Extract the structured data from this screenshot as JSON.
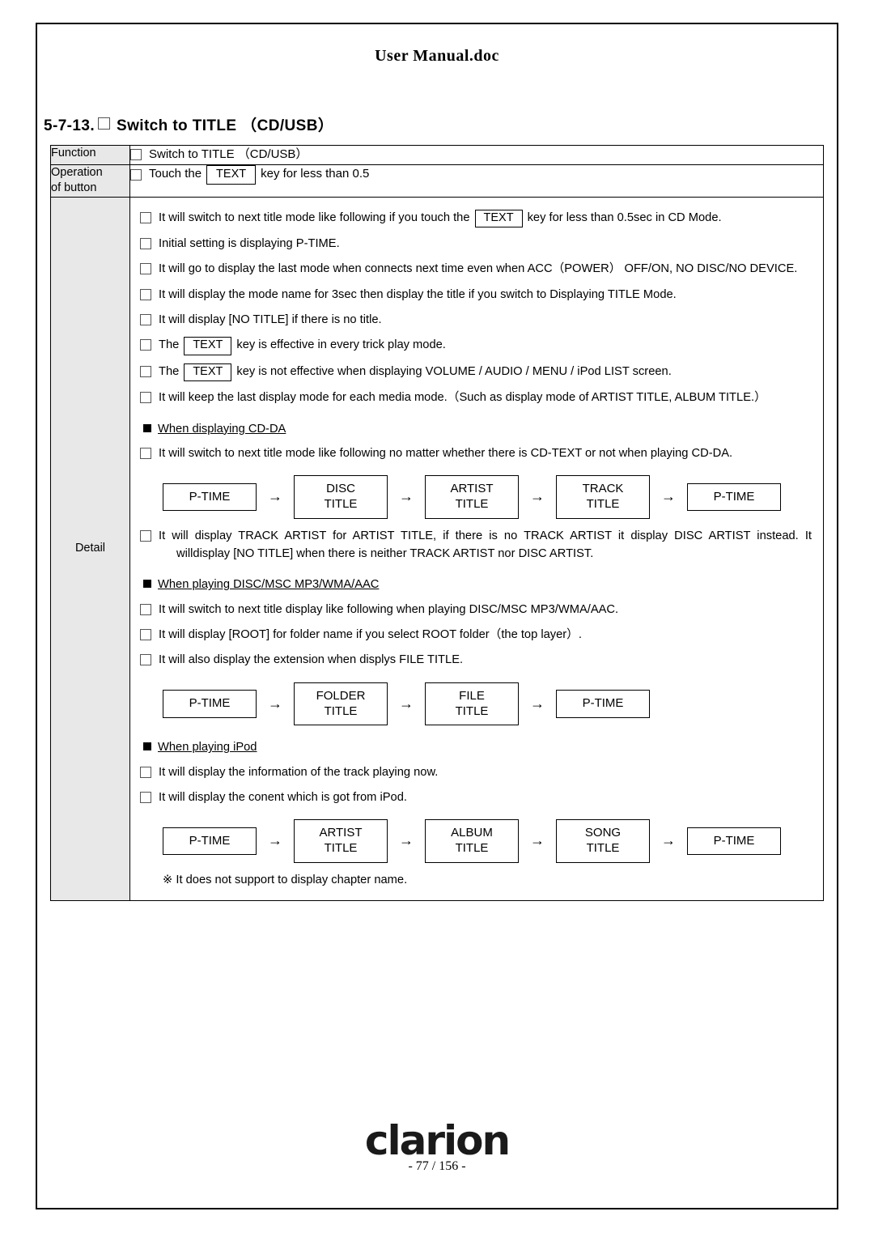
{
  "document": {
    "title": "User Manual.doc",
    "section_number": "5-7-13.",
    "section_title": "Switch to TITLE （CD/USB）",
    "brand": "clarion",
    "page_number": "- 77 / 156 -"
  },
  "table": {
    "labels": {
      "function": "Function",
      "operation_line1": "Operation",
      "operation_line2": "of button",
      "detail": "Detail"
    },
    "function_value": "Switch to TITLE （CD/USB）",
    "operation": {
      "pre": "Touch the",
      "key": "TEXT",
      "post": "key for less than 0.5"
    }
  },
  "detail": {
    "items": [
      {
        "pre": "It will switch to next title mode like following if you touch the",
        "key": "TEXT",
        "post": "key for less than 0.5sec in CD Mode."
      },
      {
        "text": "Initial setting is displaying P-TIME."
      },
      {
        "text": "It will go to display the last mode when connects next time even when ACC（POWER） OFF/ON, NO DISC/NO DEVICE."
      },
      {
        "text": "It will display the mode name for 3sec then display the title if you switch to Displaying TITLE Mode."
      },
      {
        "text": "It will display [NO TITLE] if there is no title."
      },
      {
        "pre": "The",
        "key": "TEXT",
        "post": "key is effective in every trick play mode."
      },
      {
        "pre": "The",
        "key": "TEXT",
        "post": "key is not effective when displaying VOLUME / AUDIO / MENU / iPod LIST screen."
      },
      {
        "text": "It will keep the last display mode for each media mode.（Such as display mode of ARTIST TITLE, ALBUM TITLE.）"
      }
    ],
    "section_cdda": {
      "heading": "When displaying CD-DA",
      "items": [
        {
          "text": "It will switch to next title mode like following no matter whether there is CD-TEXT or not when playing CD-DA."
        }
      ],
      "flow": [
        {
          "line1": "P-TIME",
          "line2": ""
        },
        {
          "line1": "DISC",
          "line2": "TITLE"
        },
        {
          "line1": "ARTIST",
          "line2": "TITLE"
        },
        {
          "line1": "TRACK",
          "line2": "TITLE"
        },
        {
          "line1": "P-TIME",
          "line2": ""
        }
      ],
      "after_items": [
        {
          "text": "It will display TRACK ARTIST for ARTIST TITLE, if there is no TRACK ARTIST it display DISC ARTIST instead. It",
          "indent": "willdisplay [NO TITLE] when there is neither TRACK ARTIST nor DISC ARTIST."
        }
      ]
    },
    "section_mp3": {
      "heading": "When playing DISC/MSC MP3/WMA/AAC",
      "items": [
        {
          "text": "It will switch to next title display like following when playing DISC/MSC MP3/WMA/AAC."
        },
        {
          "text": "It will display [ROOT] for folder name if you select ROOT folder（the top layer）."
        },
        {
          "text": "It will also display the extension when displys FILE TITLE."
        }
      ],
      "flow": [
        {
          "line1": "P-TIME",
          "line2": ""
        },
        {
          "line1": "FOLDER",
          "line2": "TITLE"
        },
        {
          "line1": "FILE",
          "line2": "TITLE"
        },
        {
          "line1": "P-TIME",
          "line2": ""
        }
      ]
    },
    "section_ipod": {
      "heading": "When playing iPod",
      "items": [
        {
          "text": "It will display the information of the track playing now."
        },
        {
          "text": "It will display the conent which is got from iPod."
        }
      ],
      "flow": [
        {
          "line1": "P-TIME",
          "line2": ""
        },
        {
          "line1": "ARTIST",
          "line2": "TITLE"
        },
        {
          "line1": "ALBUM",
          "line2": "TITLE"
        },
        {
          "line1": "SONG",
          "line2": "TITLE"
        },
        {
          "line1": "P-TIME",
          "line2": ""
        }
      ],
      "note": "※ It does not support to display chapter name."
    }
  },
  "arrow": "→"
}
